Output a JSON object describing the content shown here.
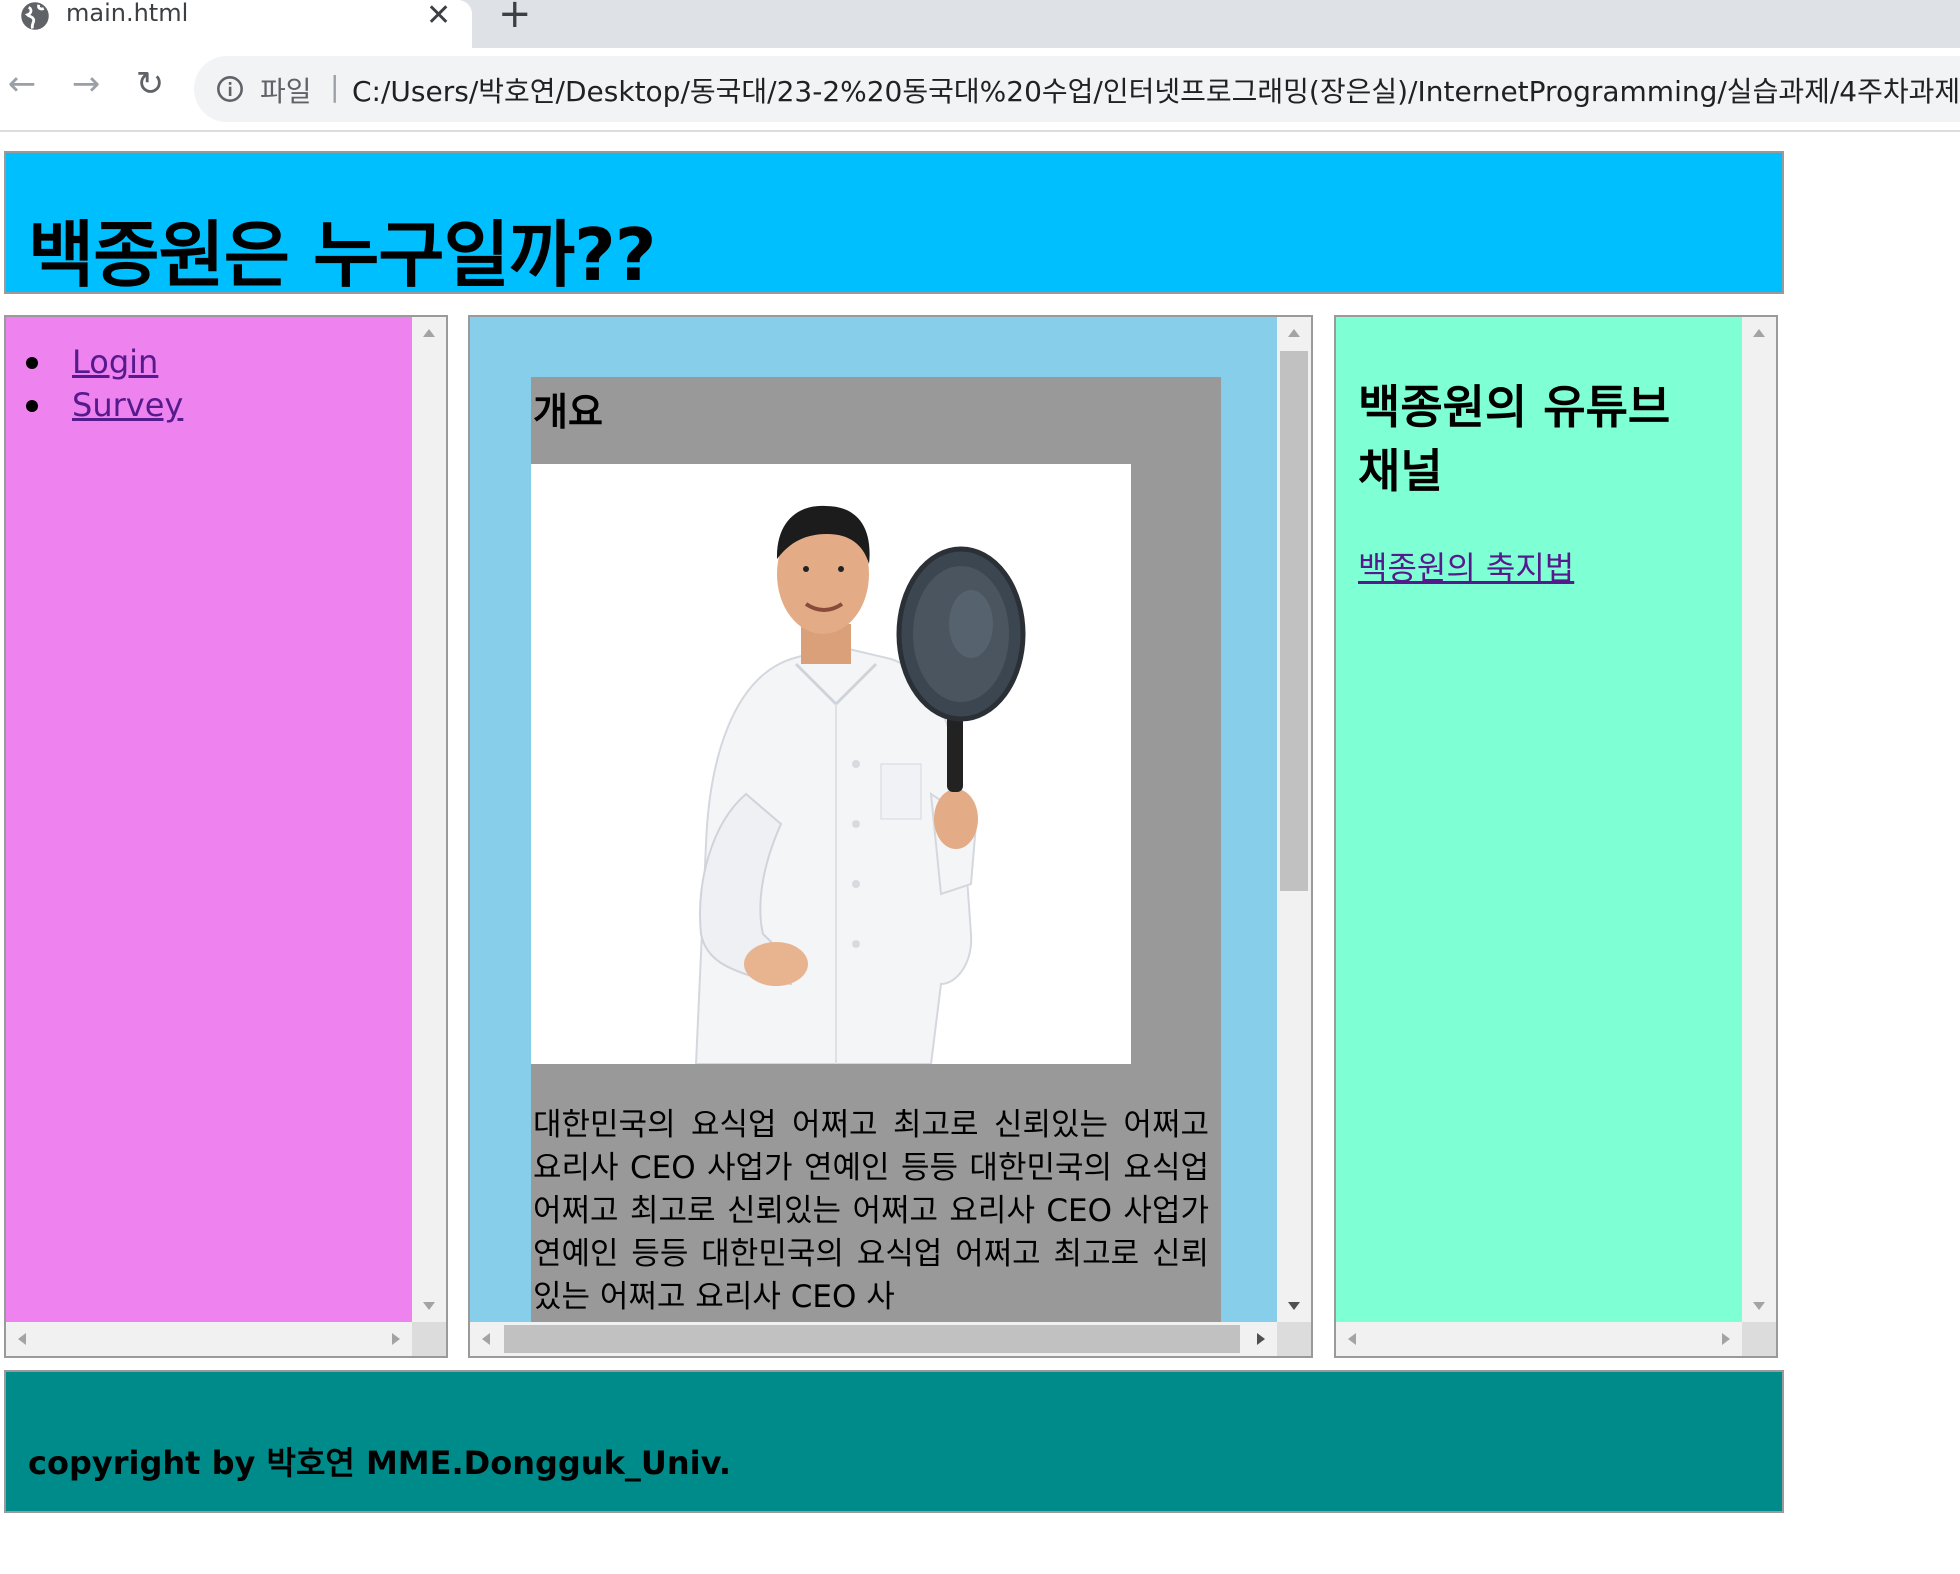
{
  "browser": {
    "tab_title": "main.html",
    "tab_close": "✕",
    "new_tab": "+",
    "back": "←",
    "forward": "→",
    "reload": "↻",
    "scheme_label": "파일",
    "separator": "|",
    "url": "C:/Users/박호연/Desktop/동국대/23-2%20동국대%20수업/인터넷프로그래밍(장은실)/InternetProgramming/실습과제/4주차과제"
  },
  "header": {
    "title": "백종원은 누구일까??"
  },
  "nav": {
    "items": [
      {
        "label": "Login"
      },
      {
        "label": "Survey"
      }
    ]
  },
  "main": {
    "heading": "개요",
    "body": "대한민국의 요식업 어쩌고 최고로 신뢰있는 어쩌고 요리사 CEO 사업가 연예인 등등 대한민국의 요식업 어쩌고 최고로 신뢰있는 어쩌고 요리사 CEO 사업가 연예인 등등 대한민국의 요식업 어쩌고 최고로 신뢰있는 어쩌고 요리사 CEO 사"
  },
  "aside": {
    "heading": "백종원의 유튜브 채널",
    "link": "백종원의 축지법"
  },
  "footer": {
    "copyright": "copyright by 박호연 MME.Dongguk_Univ."
  },
  "colors": {
    "header_bg": "#00bfff",
    "nav_bg": "#ee82ee",
    "main_bg": "#87ceeb",
    "article_bg": "#999999",
    "aside_bg": "#7fffd4",
    "footer_bg": "#008b8b",
    "link": "#551a8b"
  },
  "icons": {
    "tab": "globe-icon",
    "address": "info-icon",
    "nav": [
      "back-arrow-icon",
      "forward-arrow-icon",
      "reload-icon"
    ]
  }
}
